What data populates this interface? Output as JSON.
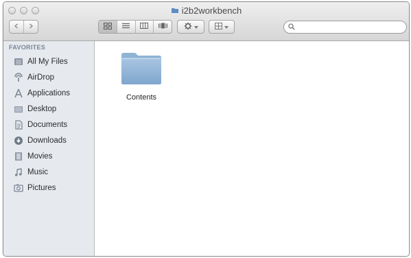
{
  "window": {
    "title": "i2b2workbench",
    "traffic_lights": [
      "close-button",
      "minimize-button",
      "zoom-button"
    ]
  },
  "toolbar": {
    "nav": {
      "back_icon": "chevron-left-icon",
      "forward_icon": "chevron-right-icon"
    },
    "view_modes": [
      {
        "name": "icon-view",
        "icon": "grid-icon",
        "active": true
      },
      {
        "name": "list-view",
        "icon": "list-icon",
        "active": false
      },
      {
        "name": "column-view",
        "icon": "columns-icon",
        "active": false
      },
      {
        "name": "cover-flow-view",
        "icon": "cover-flow-icon",
        "active": false
      }
    ],
    "action_icon": "gear-icon",
    "arrange_icon": "arrange-grid-icon",
    "search": {
      "value": "",
      "placeholder": ""
    }
  },
  "sidebar": {
    "section": "FAVORITES",
    "items": [
      {
        "label": "All My Files",
        "icon": "all-files-icon"
      },
      {
        "label": "AirDrop",
        "icon": "airdrop-icon"
      },
      {
        "label": "Applications",
        "icon": "applications-icon"
      },
      {
        "label": "Desktop",
        "icon": "desktop-icon"
      },
      {
        "label": "Documents",
        "icon": "documents-icon"
      },
      {
        "label": "Downloads",
        "icon": "downloads-icon"
      },
      {
        "label": "Movies",
        "icon": "movies-icon"
      },
      {
        "label": "Music",
        "icon": "music-icon"
      },
      {
        "label": "Pictures",
        "icon": "pictures-icon"
      }
    ]
  },
  "content": {
    "items": [
      {
        "label": "Contents",
        "icon": "folder-icon"
      }
    ]
  },
  "colors": {
    "sidebar_bg": "#e6eaef",
    "folder_blue": "#8fb3d4",
    "toolbar_top": "#efefef",
    "toolbar_bottom": "#d6d6d6"
  }
}
